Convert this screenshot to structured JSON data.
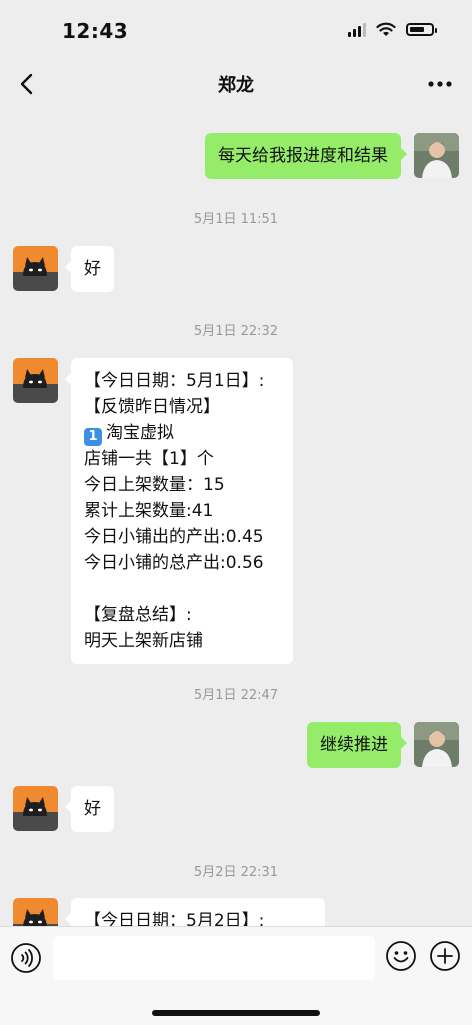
{
  "status_bar": {
    "time": "12:43"
  },
  "header": {
    "title": "郑龙"
  },
  "messages": [
    {
      "type": "text",
      "side": "right",
      "text": "每天给我报进度和结果"
    },
    {
      "type": "time",
      "text": "5月1日 11:51"
    },
    {
      "type": "text",
      "side": "left",
      "text": "好"
    },
    {
      "type": "time",
      "text": "5月1日 22:32"
    },
    {
      "type": "report",
      "side": "left",
      "lines": [
        "【今日日期：5月1日】:",
        "【反馈昨日情况】",
        "淘宝虚拟",
        "店铺一共【1】个",
        "今日上架数量：15",
        "累计上架数量:41",
        "今日小铺出的产出:0.45",
        "今日小铺的总产出:0.56",
        "",
        "【复盘总结】:",
        "明天上架新店铺"
      ],
      "keycap": "1"
    },
    {
      "type": "time",
      "text": "5月1日 22:47"
    },
    {
      "type": "text",
      "side": "right",
      "text": "继续推进"
    },
    {
      "type": "text",
      "side": "left",
      "text": "好"
    },
    {
      "type": "time",
      "text": "5月2日 22:31"
    },
    {
      "type": "report_partial",
      "side": "left",
      "text": "【今日日期：5月2日】:"
    }
  ],
  "icons": {
    "back": "chevron-left-icon",
    "more": "more-dots-icon",
    "voice": "voice-icon",
    "emoji": "emoji-icon",
    "plus": "plus-icon"
  },
  "colors": {
    "background": "#ededed",
    "bubble_self": "#95ec69",
    "bubble_other": "#ffffff",
    "timestamp": "#999999",
    "keycap": "#3c8fe4"
  }
}
